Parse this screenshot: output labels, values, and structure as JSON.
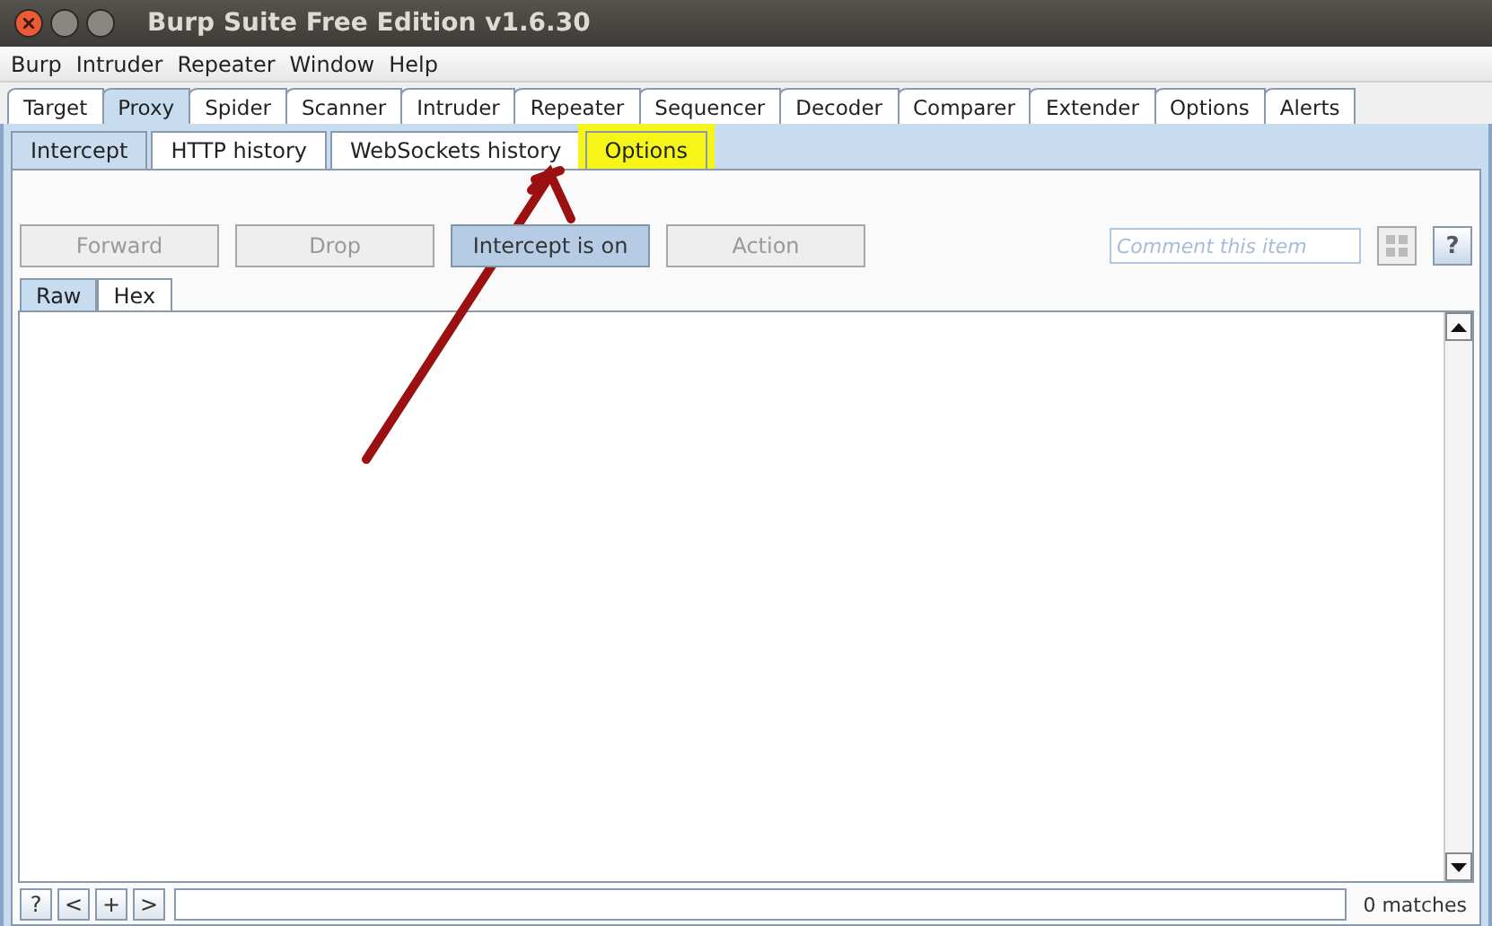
{
  "window": {
    "title": "Burp Suite Free Edition v1.6.30"
  },
  "menu": [
    "Burp",
    "Intruder",
    "Repeater",
    "Window",
    "Help"
  ],
  "tabs": [
    {
      "label": "Target",
      "selected": false
    },
    {
      "label": "Proxy",
      "selected": true
    },
    {
      "label": "Spider",
      "selected": false
    },
    {
      "label": "Scanner",
      "selected": false
    },
    {
      "label": "Intruder",
      "selected": false
    },
    {
      "label": "Repeater",
      "selected": false
    },
    {
      "label": "Sequencer",
      "selected": false
    },
    {
      "label": "Decoder",
      "selected": false
    },
    {
      "label": "Comparer",
      "selected": false
    },
    {
      "label": "Extender",
      "selected": false
    },
    {
      "label": "Options",
      "selected": false
    },
    {
      "label": "Alerts",
      "selected": false
    }
  ],
  "subtabs": [
    {
      "label": "Intercept",
      "selected": true,
      "highlighted": false
    },
    {
      "label": "HTTP history",
      "selected": false,
      "highlighted": false
    },
    {
      "label": "WebSockets history",
      "selected": false,
      "highlighted": false
    },
    {
      "label": "Options",
      "selected": false,
      "highlighted": true
    }
  ],
  "buttons": [
    {
      "label": "Forward",
      "disabled": true,
      "on": false
    },
    {
      "label": "Drop",
      "disabled": true,
      "on": false
    },
    {
      "label": "Intercept is on",
      "disabled": false,
      "on": true
    },
    {
      "label": "Action",
      "disabled": true,
      "on": false
    }
  ],
  "comment": {
    "placeholder": "Comment this item"
  },
  "help_button": "?",
  "view_tabs": [
    {
      "label": "Raw",
      "selected": true
    },
    {
      "label": "Hex",
      "selected": false
    }
  ],
  "search_bar": {
    "buttons": [
      "?",
      "<",
      "+",
      ">"
    ],
    "matches": "0 matches"
  },
  "annotations": [
    {
      "kind": "arrow"
    }
  ]
}
